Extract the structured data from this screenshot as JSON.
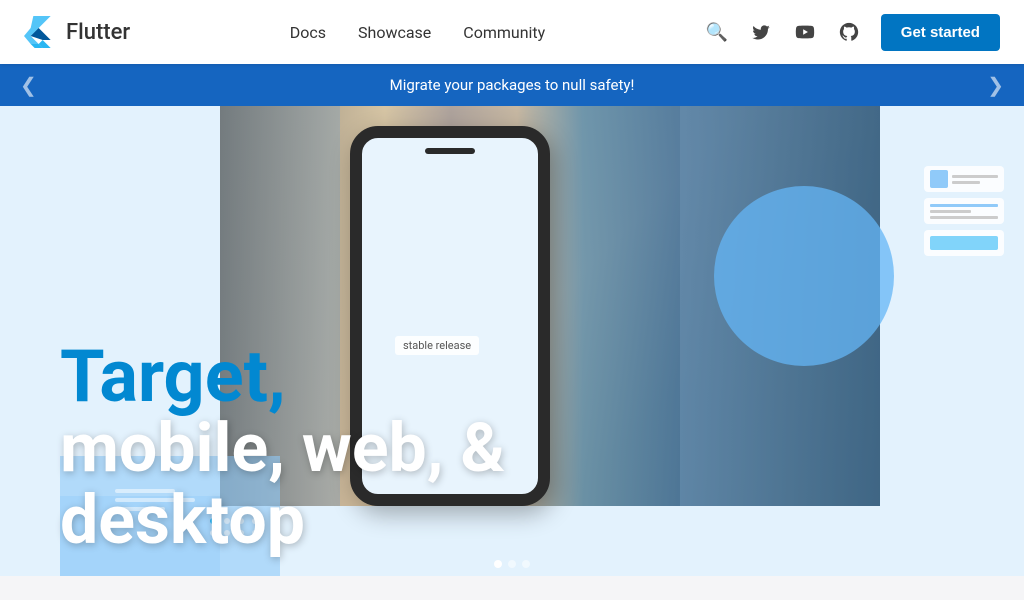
{
  "navbar": {
    "brand": "Flutter",
    "links": [
      {
        "label": "Docs",
        "id": "docs"
      },
      {
        "label": "Showcase",
        "id": "showcase"
      },
      {
        "label": "Community",
        "id": "community"
      }
    ],
    "cta": "Get started",
    "icons": {
      "search": "🔍",
      "twitter": "🐦",
      "youtube": "▶",
      "github": "⌥"
    }
  },
  "banner": {
    "text": "Migrate your packages to null safety!",
    "chevron_left": "❮",
    "chevron_right": "❯"
  },
  "hero": {
    "title_top": "Target,",
    "stable_label": "stable release",
    "title_bottom": "mobile, web, &\ndesktop"
  }
}
